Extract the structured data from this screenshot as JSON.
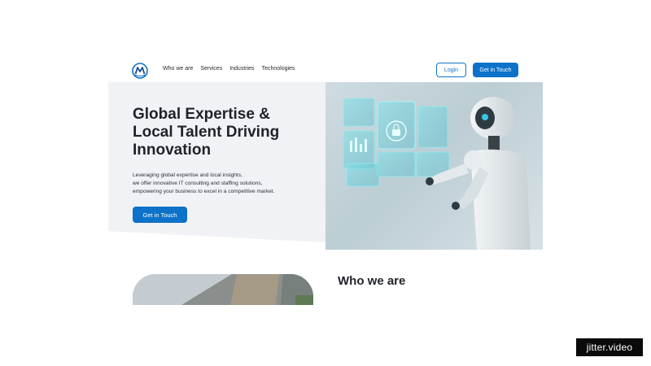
{
  "nav": {
    "logo_icon": "m-logo-icon",
    "links": [
      "Who we are",
      "Services",
      "Industries",
      "Technologies"
    ],
    "login_label": "Login",
    "cta_label": "Get in Touch"
  },
  "hero": {
    "title": "Global Expertise & Local Talent Driving Innovation",
    "description_lines": [
      "Leveraging global expertise and local insights,",
      "we offer innovative IT consulting and staffing solutions,",
      "empowering your business to excel in a competitive market."
    ],
    "cta_label": "Get in Touch",
    "image": "robot-hologram-image"
  },
  "who": {
    "title": "Who we are",
    "image": "building-image"
  },
  "watermark": {
    "text": "jitter.video"
  },
  "colors": {
    "accent": "#0d72c9",
    "hero_bg": "#f1f2f6",
    "text": "#1f2329"
  }
}
